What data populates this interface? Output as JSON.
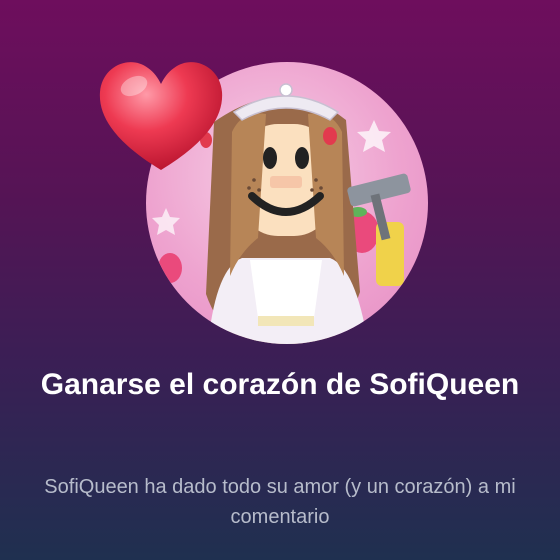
{
  "achievement": {
    "title": "Ganarse el corazón de SofiQueen",
    "description": "SofiQueen ha dado todo su amor (y un corazón) a mi comentario"
  },
  "icons": {
    "badge": "heart-icon",
    "avatar": "avatar-image"
  },
  "colors": {
    "background_top": "#6e0e5d",
    "background_bottom": "#1f3050",
    "heart": "#e8283f",
    "title": "#ffffff",
    "description": "#b7bccb"
  }
}
